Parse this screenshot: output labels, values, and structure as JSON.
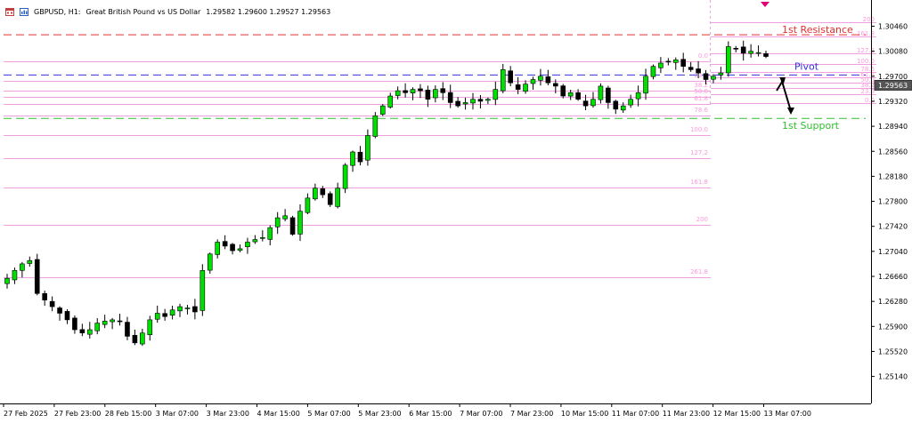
{
  "header": {
    "symbol": "GBPUSD, H1:",
    "description": "Great British Pound vs US Dollar",
    "ohlc": "1.29582 1.29600 1.29527 1.29563"
  },
  "icons": [
    "calendar-icon",
    "chart-icon",
    "active-marker-icon"
  ],
  "colors": {
    "bull": "#00e000",
    "bear": "#000000",
    "fib": "#f0a0e0",
    "fib_text": "#ff99dd",
    "resistance": "#e03030",
    "pivot": "#3030e0",
    "support": "#30c030",
    "grid": "#dddddd"
  },
  "annotations": {
    "resistance": "1st Resistance",
    "pivot": "Pivot",
    "support": "1st Support"
  },
  "price_axis": {
    "ticks": [
      "1.30460",
      "1.30080",
      "1.29700",
      "1.29320",
      "1.28940",
      "1.28560",
      "1.28180",
      "1.27800",
      "1.27420",
      "1.27040",
      "1.26660",
      "1.26280",
      "1.25900",
      "1.25520",
      "1.25140"
    ],
    "current": "1.29563"
  },
  "time_axis": {
    "ticks": [
      "27 Feb 2025",
      "27 Feb 23:00",
      "28 Feb 15:00",
      "3 Mar 07:00",
      "3 Mar 23:00",
      "4 Mar 15:00",
      "5 Mar 07:00",
      "5 Mar 23:00",
      "6 Mar 15:00",
      "7 Mar 07:00",
      "7 Mar 23:00",
      "10 Mar 15:00",
      "11 Mar 07:00",
      "11 Mar 23:00",
      "12 Mar 15:00",
      "13 Mar 07:00"
    ]
  },
  "fib_main": {
    "labels": [
      "0.0",
      "23.6",
      "38.2",
      "50.0",
      "61.8",
      "78.6",
      "100.0",
      "127.2",
      "161.8",
      "200",
      "261.8"
    ]
  },
  "fib_small": {
    "labels": [
      "200",
      "161.8",
      "127.2",
      "100.0",
      "78.6",
      "61.8",
      "50.0",
      "38.2",
      "23.6",
      "0.0"
    ]
  },
  "chart_data": {
    "type": "candlestick",
    "symbol": "GBPUSD",
    "timeframe": "H1",
    "ylim": [
      1.2495,
      1.3065
    ],
    "levels": {
      "resistance": 1.3033,
      "pivot": 1.2972,
      "support": 1.2906
    },
    "closes": [
      1.2663,
      1.2675,
      1.2685,
      1.269,
      1.264,
      1.263,
      1.262,
      1.261,
      1.26,
      1.2585,
      1.258,
      1.2585,
      1.2595,
      1.2598,
      1.26,
      1.2598,
      1.2575,
      1.2565,
      1.258,
      1.26,
      1.261,
      1.2605,
      1.2615,
      1.262,
      1.2618,
      1.2612,
      1.2675,
      1.27,
      1.2718,
      1.2712,
      1.2705,
      1.2708,
      1.2718,
      1.2722,
      1.2725,
      1.274,
      1.2755,
      1.2758,
      1.273,
      1.2765,
      1.2785,
      1.28,
      1.279,
      1.2775,
      1.28,
      1.2835,
      1.2855,
      1.284,
      1.288,
      1.291,
      1.2925,
      1.294,
      1.2948,
      1.2945,
      1.295,
      1.2948,
      1.2935,
      1.295,
      1.2945,
      1.293,
      1.2925,
      1.293,
      1.2935,
      1.2932,
      1.2935,
      1.295,
      1.298,
      1.296,
      1.295,
      1.2958,
      1.2965,
      1.297,
      1.296,
      1.2955,
      1.294,
      1.2945,
      1.2935,
      1.2925,
      1.2935,
      1.2955,
      1.293,
      1.292,
      1.2925,
      1.2935,
      1.2945,
      1.297,
      1.2985,
      1.299,
      1.2992,
      1.2995,
      1.2985,
      1.298,
      1.2975,
      1.2965,
      1.297,
      1.2975,
      1.3015,
      1.3012,
      1.3005,
      1.3008,
      1.3006,
      1.3
    ]
  }
}
